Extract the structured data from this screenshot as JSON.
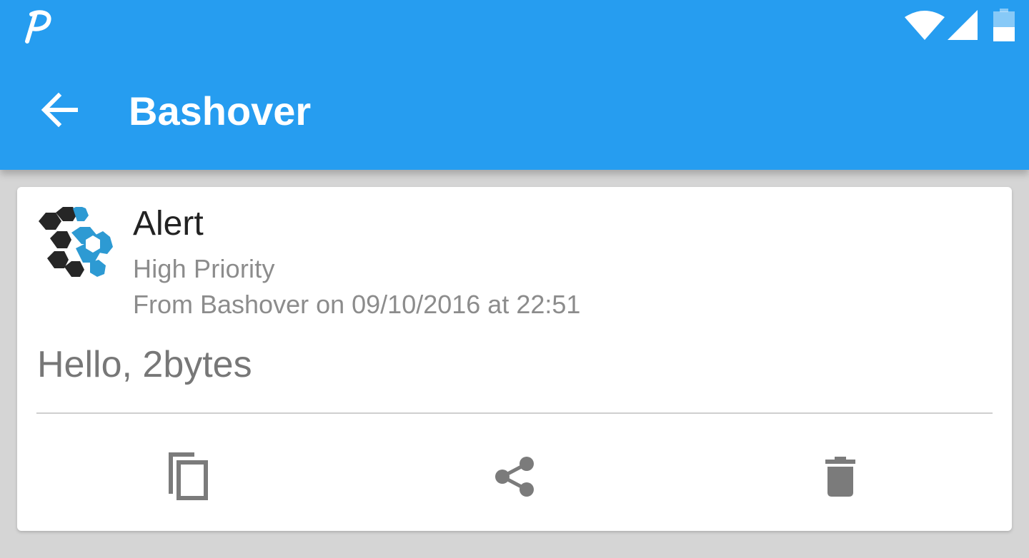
{
  "status_bar": {
    "app_icon": "pushover-icon",
    "icons": [
      "wifi-icon",
      "cellular-signal-icon",
      "battery-icon"
    ]
  },
  "toolbar": {
    "back_icon": "arrow-back-icon",
    "title": "Bashover"
  },
  "message": {
    "app_icon": "bashover-logo",
    "title": "Alert",
    "priority": "High Priority",
    "meta": "From Bashover on 09/10/2016 at 22:51",
    "body": "Hello, 2bytes"
  },
  "actions": [
    {
      "icon": "copy-icon"
    },
    {
      "icon": "share-icon"
    },
    {
      "icon": "delete-icon"
    }
  ],
  "colors": {
    "primary": "#269df0",
    "background": "#d5d5d5",
    "card": "#ffffff",
    "icon_gray": "#7b7b7b",
    "logo_blue": "#2d9ad3",
    "logo_dark": "#262626"
  }
}
